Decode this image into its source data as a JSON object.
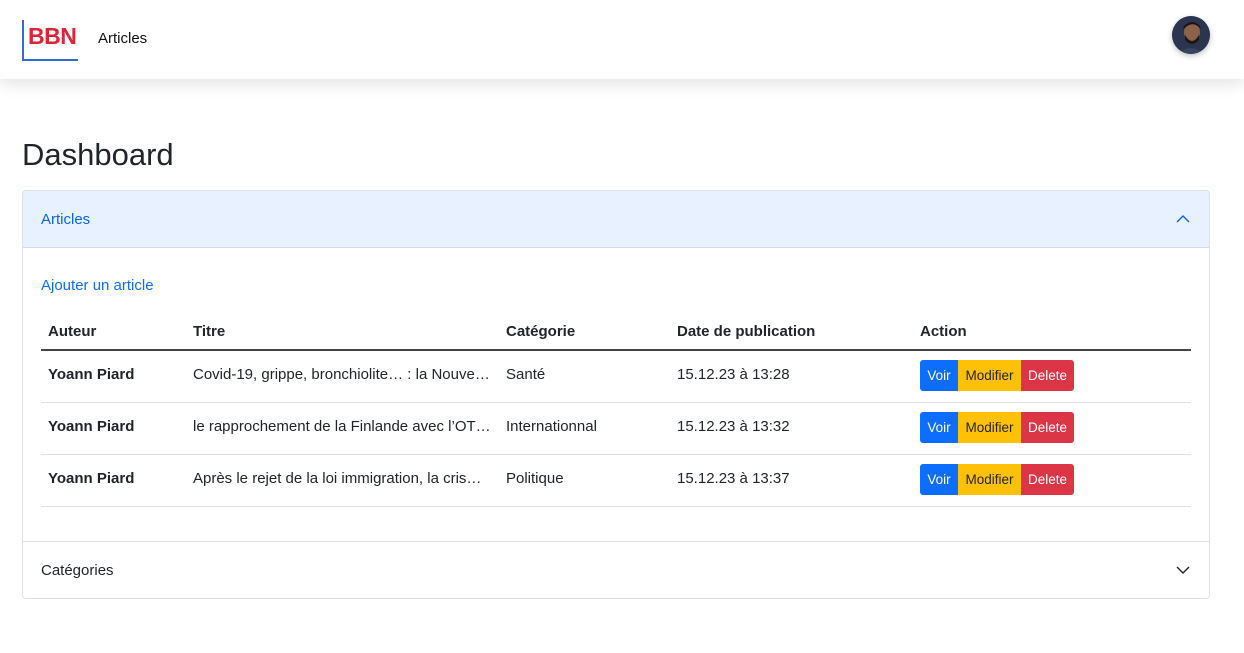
{
  "navbar": {
    "brand": "BBN",
    "links": [
      "Articles"
    ],
    "avatar_alt": "user-avatar"
  },
  "page": {
    "title": "Dashboard"
  },
  "accordion": {
    "sections": [
      {
        "label": "Articles",
        "expanded": true,
        "add_link": "Ajouter un article",
        "table": {
          "headers": [
            "Auteur",
            "Titre",
            "Catégorie",
            "Date de publication",
            "Action"
          ],
          "rows": [
            {
              "author": "Yoann Piard",
              "title": "Covid-19, grippe, bronchiolite… : la Nouve…",
              "category": "Santé",
              "date": "15.12.23 à 13:28"
            },
            {
              "author": "Yoann Piard",
              "title": "le rapprochement de la Finlande avec l’OT…",
              "category": "Internationnal",
              "date": "15.12.23 à 13:32"
            },
            {
              "author": "Yoann Piard",
              "title": "Après le rejet de la loi immigration, la cris…",
              "category": "Politique",
              "date": "15.12.23 à 13:37"
            }
          ],
          "actions": {
            "view": "Voir",
            "edit": "Modifier",
            "delete": "Delete"
          }
        }
      },
      {
        "label": "Catégories",
        "expanded": false
      }
    ]
  },
  "colors": {
    "brand_red": "#e02436",
    "brand_blue": "#2f6ecf",
    "primary": "#0d6efd",
    "warning": "#ffc107",
    "danger": "#dc3545",
    "accordion_active_bg": "#e7f1ff"
  },
  "icons": {
    "expanded_indicator": "chevron-up-icon",
    "collapsed_indicator": "chevron-down-icon"
  }
}
